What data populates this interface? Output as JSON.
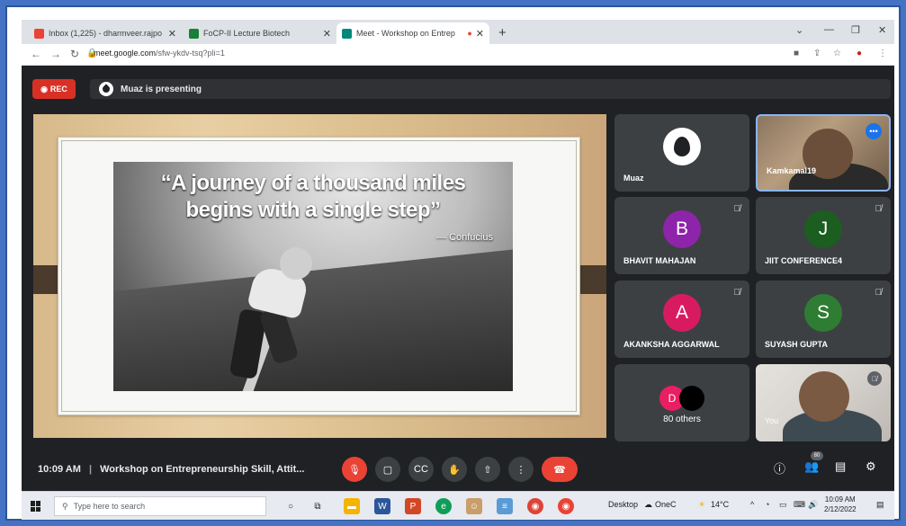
{
  "browser": {
    "tabs": [
      {
        "title": "Inbox (1,225) - dharmveer.rajpo",
        "favicon_color": "#ea4335"
      },
      {
        "title": "FoCP-II Lecture Biotech",
        "favicon_color": "#188038"
      },
      {
        "title": "Meet - Workshop on Entrep",
        "favicon_color": "#00897b",
        "active": true
      }
    ],
    "url_host": "meet.google.com",
    "url_path": "/sfw-ykdv-tsq?pli=1"
  },
  "meet": {
    "rec_label": "REC",
    "presenting_text": "Muaz is presenting",
    "slide": {
      "quote_line1": "“A journey of a thousand miles",
      "quote_line2": "begins with a single step”",
      "author": "— Confucius"
    },
    "tiles": [
      {
        "name": "Muaz",
        "kind": "logo"
      },
      {
        "name": "Kamkamal19",
        "kind": "camera",
        "speaking": true
      },
      {
        "name": "BHAVIT MAHAJAN",
        "initial": "B",
        "color": "#8e24aa",
        "muted": true
      },
      {
        "name": "JIIT CONFERENCE4",
        "initial": "J",
        "color": "#1b5e20",
        "muted": true
      },
      {
        "name": "AKANKSHA AGGARWAL",
        "initial": "A",
        "color": "#d81b60",
        "muted": true
      },
      {
        "name": "SUYASH GUPTA",
        "initial": "S",
        "color": "#2e7d32",
        "muted": true
      },
      {
        "others_label": "80 others",
        "initial": "D",
        "color": "#e91e63"
      },
      {
        "name": "You",
        "kind": "camera",
        "muted": true
      }
    ],
    "bottom": {
      "time": "10:09 AM",
      "separator": "|",
      "meeting_title": "Workshop on Entrepreneurship Skill, Attit...",
      "people_count": "80"
    }
  },
  "taskbar": {
    "search_placeholder": "Type here to search",
    "desktop_label": "Desktop",
    "onedrive_label": "OneC",
    "temperature": "14°C",
    "clock_time": "10:09 AM",
    "clock_date": "2/12/2022"
  }
}
